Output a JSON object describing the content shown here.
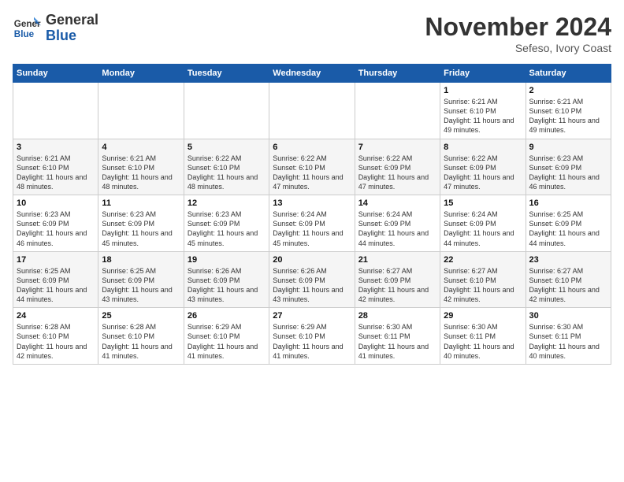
{
  "logo": {
    "line1": "General",
    "line2": "Blue"
  },
  "title": "November 2024",
  "subtitle": "Sefeso, Ivory Coast",
  "days_of_week": [
    "Sunday",
    "Monday",
    "Tuesday",
    "Wednesday",
    "Thursday",
    "Friday",
    "Saturday"
  ],
  "weeks": [
    [
      {
        "day": "",
        "info": ""
      },
      {
        "day": "",
        "info": ""
      },
      {
        "day": "",
        "info": ""
      },
      {
        "day": "",
        "info": ""
      },
      {
        "day": "",
        "info": ""
      },
      {
        "day": "1",
        "info": "Sunrise: 6:21 AM\nSunset: 6:10 PM\nDaylight: 11 hours and 49 minutes."
      },
      {
        "day": "2",
        "info": "Sunrise: 6:21 AM\nSunset: 6:10 PM\nDaylight: 11 hours and 49 minutes."
      }
    ],
    [
      {
        "day": "3",
        "info": "Sunrise: 6:21 AM\nSunset: 6:10 PM\nDaylight: 11 hours and 48 minutes."
      },
      {
        "day": "4",
        "info": "Sunrise: 6:21 AM\nSunset: 6:10 PM\nDaylight: 11 hours and 48 minutes."
      },
      {
        "day": "5",
        "info": "Sunrise: 6:22 AM\nSunset: 6:10 PM\nDaylight: 11 hours and 48 minutes."
      },
      {
        "day": "6",
        "info": "Sunrise: 6:22 AM\nSunset: 6:10 PM\nDaylight: 11 hours and 47 minutes."
      },
      {
        "day": "7",
        "info": "Sunrise: 6:22 AM\nSunset: 6:09 PM\nDaylight: 11 hours and 47 minutes."
      },
      {
        "day": "8",
        "info": "Sunrise: 6:22 AM\nSunset: 6:09 PM\nDaylight: 11 hours and 47 minutes."
      },
      {
        "day": "9",
        "info": "Sunrise: 6:23 AM\nSunset: 6:09 PM\nDaylight: 11 hours and 46 minutes."
      }
    ],
    [
      {
        "day": "10",
        "info": "Sunrise: 6:23 AM\nSunset: 6:09 PM\nDaylight: 11 hours and 46 minutes."
      },
      {
        "day": "11",
        "info": "Sunrise: 6:23 AM\nSunset: 6:09 PM\nDaylight: 11 hours and 45 minutes."
      },
      {
        "day": "12",
        "info": "Sunrise: 6:23 AM\nSunset: 6:09 PM\nDaylight: 11 hours and 45 minutes."
      },
      {
        "day": "13",
        "info": "Sunrise: 6:24 AM\nSunset: 6:09 PM\nDaylight: 11 hours and 45 minutes."
      },
      {
        "day": "14",
        "info": "Sunrise: 6:24 AM\nSunset: 6:09 PM\nDaylight: 11 hours and 44 minutes."
      },
      {
        "day": "15",
        "info": "Sunrise: 6:24 AM\nSunset: 6:09 PM\nDaylight: 11 hours and 44 minutes."
      },
      {
        "day": "16",
        "info": "Sunrise: 6:25 AM\nSunset: 6:09 PM\nDaylight: 11 hours and 44 minutes."
      }
    ],
    [
      {
        "day": "17",
        "info": "Sunrise: 6:25 AM\nSunset: 6:09 PM\nDaylight: 11 hours and 44 minutes."
      },
      {
        "day": "18",
        "info": "Sunrise: 6:25 AM\nSunset: 6:09 PM\nDaylight: 11 hours and 43 minutes."
      },
      {
        "day": "19",
        "info": "Sunrise: 6:26 AM\nSunset: 6:09 PM\nDaylight: 11 hours and 43 minutes."
      },
      {
        "day": "20",
        "info": "Sunrise: 6:26 AM\nSunset: 6:09 PM\nDaylight: 11 hours and 43 minutes."
      },
      {
        "day": "21",
        "info": "Sunrise: 6:27 AM\nSunset: 6:09 PM\nDaylight: 11 hours and 42 minutes."
      },
      {
        "day": "22",
        "info": "Sunrise: 6:27 AM\nSunset: 6:10 PM\nDaylight: 11 hours and 42 minutes."
      },
      {
        "day": "23",
        "info": "Sunrise: 6:27 AM\nSunset: 6:10 PM\nDaylight: 11 hours and 42 minutes."
      }
    ],
    [
      {
        "day": "24",
        "info": "Sunrise: 6:28 AM\nSunset: 6:10 PM\nDaylight: 11 hours and 42 minutes."
      },
      {
        "day": "25",
        "info": "Sunrise: 6:28 AM\nSunset: 6:10 PM\nDaylight: 11 hours and 41 minutes."
      },
      {
        "day": "26",
        "info": "Sunrise: 6:29 AM\nSunset: 6:10 PM\nDaylight: 11 hours and 41 minutes."
      },
      {
        "day": "27",
        "info": "Sunrise: 6:29 AM\nSunset: 6:10 PM\nDaylight: 11 hours and 41 minutes."
      },
      {
        "day": "28",
        "info": "Sunrise: 6:30 AM\nSunset: 6:11 PM\nDaylight: 11 hours and 41 minutes."
      },
      {
        "day": "29",
        "info": "Sunrise: 6:30 AM\nSunset: 6:11 PM\nDaylight: 11 hours and 40 minutes."
      },
      {
        "day": "30",
        "info": "Sunrise: 6:30 AM\nSunset: 6:11 PM\nDaylight: 11 hours and 40 minutes."
      }
    ]
  ]
}
